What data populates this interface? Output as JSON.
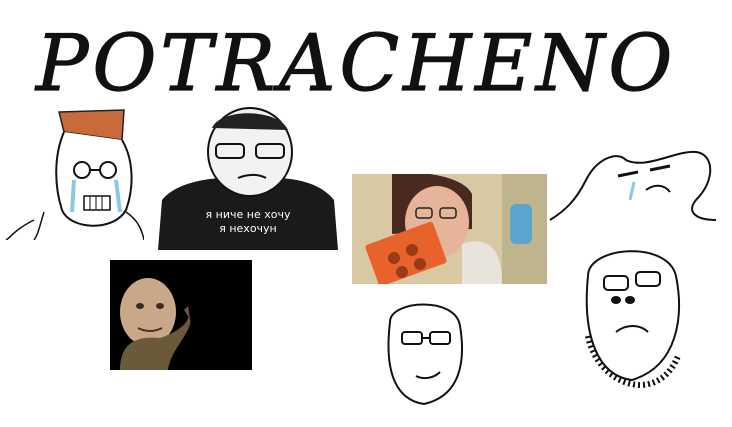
{
  "title": "POTRACHENO",
  "shirt_caption": {
    "line1": "я ниче не хочу",
    "line2": "я нехочун"
  },
  "colors": {
    "background": "#ffffff",
    "ink": "#111111",
    "hair": "#c96a3b",
    "tears": "#8cc8e6",
    "brick": "#e8632c",
    "shirt": "#1a1a1a"
  }
}
